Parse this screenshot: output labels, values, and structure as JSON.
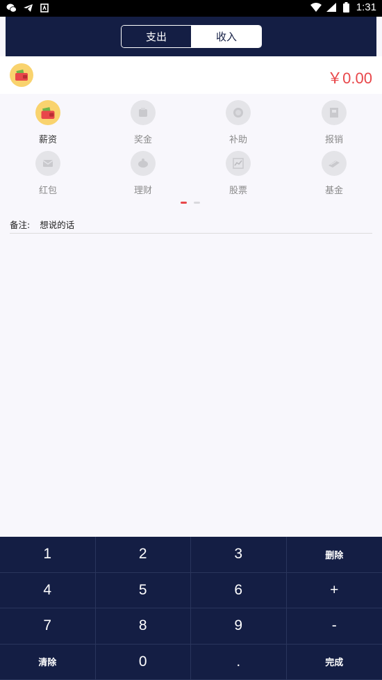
{
  "status_bar": {
    "time": "1:31",
    "left_icons": [
      "wechat-icon",
      "telegram-icon",
      "notification-icon"
    ],
    "right_icons": [
      "wifi-icon",
      "signal-icon",
      "battery-icon"
    ]
  },
  "header": {
    "tabs": [
      {
        "label": "支出",
        "selected": false
      },
      {
        "label": "收入",
        "selected": true
      }
    ]
  },
  "amount": {
    "icon": "wallet-icon",
    "value": "￥0.00"
  },
  "categories": [
    {
      "label": "薪资",
      "icon": "wallet-icon",
      "selected": true
    },
    {
      "label": "奖金",
      "icon": "money-bag-icon",
      "selected": false
    },
    {
      "label": "补助",
      "icon": "coin-icon",
      "selected": false
    },
    {
      "label": "报销",
      "icon": "receipt-icon",
      "selected": false
    },
    {
      "label": "红包",
      "icon": "red-envelope-icon",
      "selected": false
    },
    {
      "label": "理财",
      "icon": "piggy-bank-icon",
      "selected": false
    },
    {
      "label": "股票",
      "icon": "stock-chart-icon",
      "selected": false
    },
    {
      "label": "基金",
      "icon": "gold-bar-icon",
      "selected": false
    }
  ],
  "pager": {
    "pages": 2,
    "current": 1
  },
  "note": {
    "label": "备注:",
    "placeholder": "想说的话"
  },
  "keypad": {
    "keys": [
      "1",
      "2",
      "3",
      "删除",
      "4",
      "5",
      "6",
      "+",
      "7",
      "8",
      "9",
      "-",
      "清除",
      "0",
      ".",
      "完成"
    ]
  },
  "colors": {
    "header_bg": "#141e44",
    "accent_red": "#e8474a",
    "selected_circle": "#f9d36e",
    "page_bg": "#f8f7fc"
  }
}
